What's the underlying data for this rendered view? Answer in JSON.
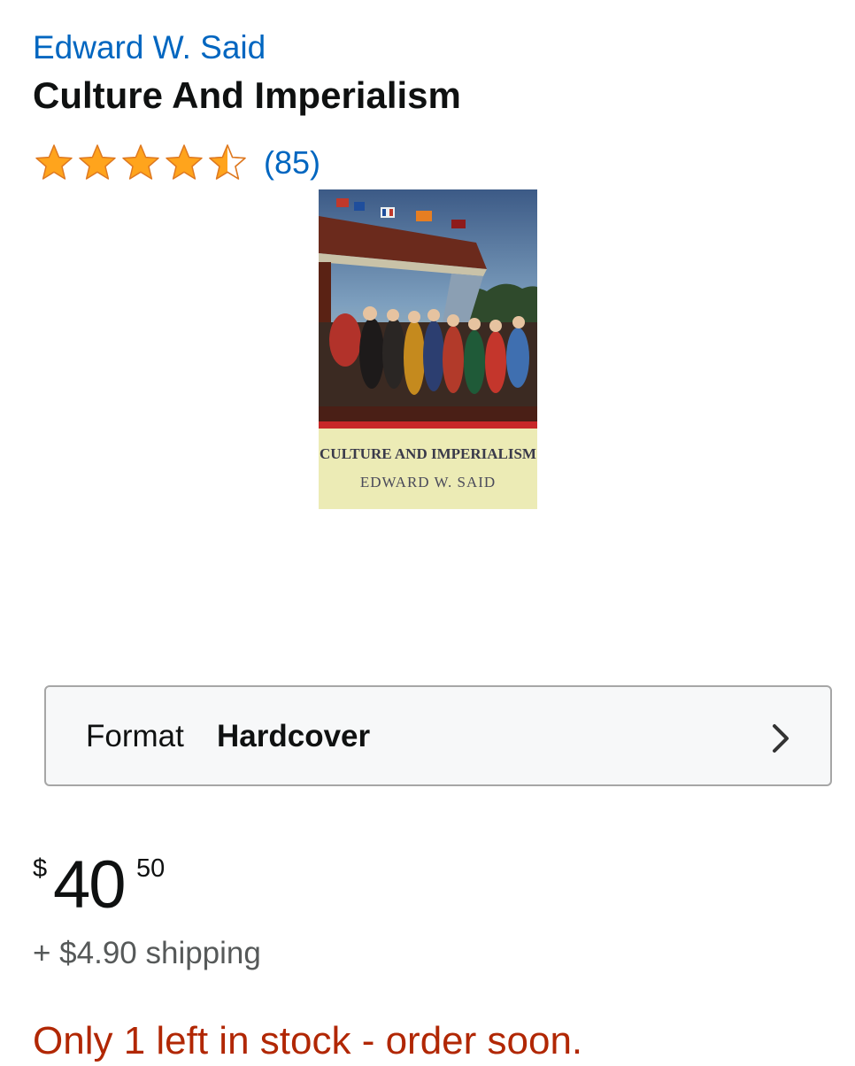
{
  "product": {
    "author": "Edward W. Said",
    "title": "Culture And Imperialism",
    "rating": {
      "stars": 4.5,
      "review_count_text": "(85)"
    },
    "cover": {
      "title_text": "CULTURE AND IMPERIALISM",
      "author_text": "EDWARD W. SAID"
    }
  },
  "format": {
    "label": "Format",
    "value": "Hardcover",
    "icon": "chevron-right-icon"
  },
  "price": {
    "symbol": "$",
    "whole": "40",
    "fraction": "50"
  },
  "shipping_text": "+ $4.90 shipping",
  "stock_text": "Only 1 left in stock - order soon.",
  "colors": {
    "link": "#0066c0",
    "star": "#ffa41c",
    "stock": "#b12704",
    "muted": "#565959"
  }
}
